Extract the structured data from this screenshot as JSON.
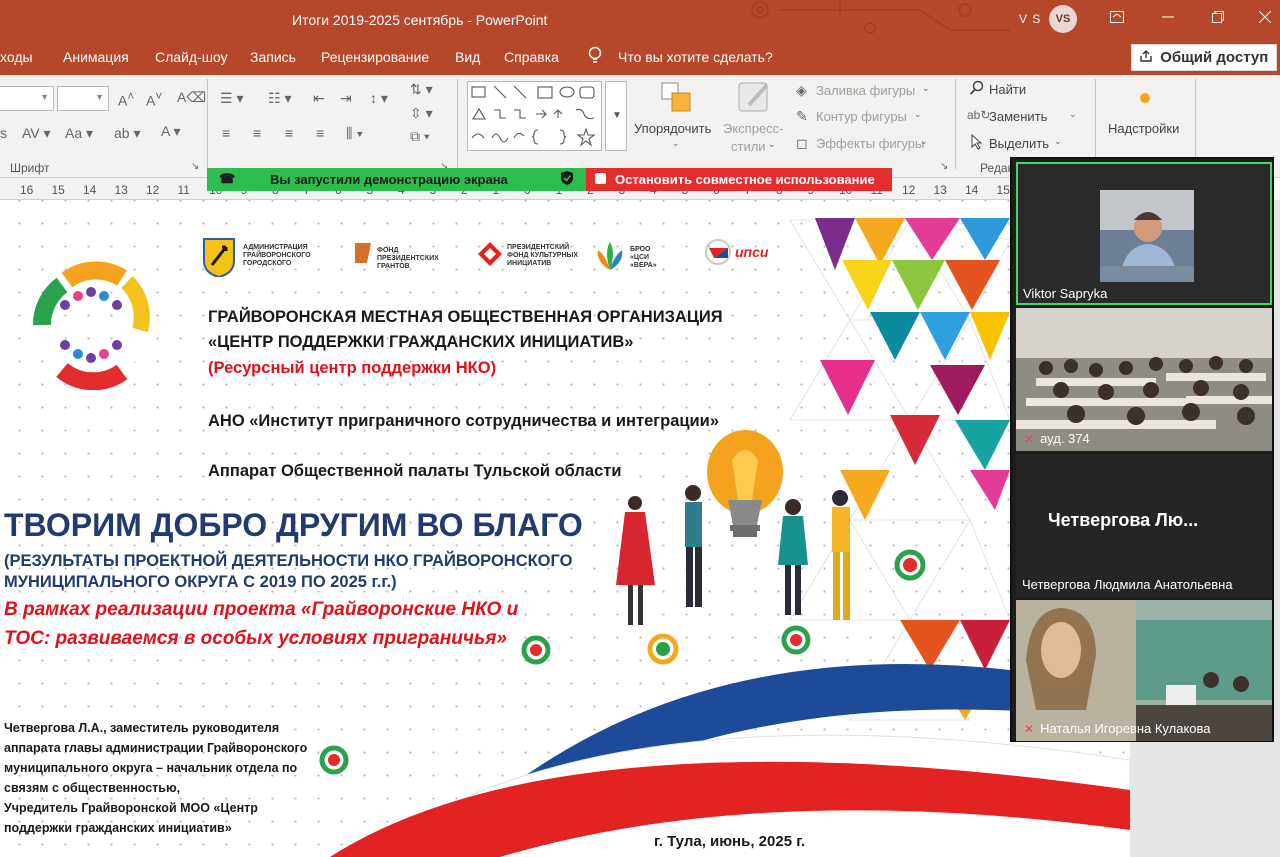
{
  "window": {
    "title": "Итоги 2019-2025 сентябрь  -  PowerPoint",
    "user_initials": "V S",
    "avatar_initials": "VS"
  },
  "menu": {
    "items": [
      "ходы",
      "Анимация",
      "Слайд-шоу",
      "Запись",
      "Рецензирование",
      "Вид",
      "Справка"
    ],
    "tell_me": "Что вы хотите сделать?",
    "share_label": "Общий доступ"
  },
  "ribbon": {
    "font_group_label": "Шрифт",
    "arrange_label": "Упорядочить",
    "express_styles_label_1": "Экспресс-",
    "express_styles_label_2": "стили",
    "shape_fill": "Заливка фигуры",
    "shape_outline": "Контур фигуры",
    "shape_effects": "Эффекты фигуры",
    "find": "Найти",
    "replace": "Заменить",
    "select": "Выделить",
    "editing_group": "Редак",
    "addins": "Надстройки"
  },
  "screen_share": {
    "started": "Вы запустили демонстрацию экрана",
    "stop": "Остановить совместное использование"
  },
  "ruler": {
    "ticks": [
      "16",
      "15",
      "14",
      "13",
      "12",
      "11",
      "10",
      "9",
      "8",
      "7",
      "6",
      "5",
      "4",
      "3",
      "2",
      "1",
      "0",
      "1",
      "2",
      "3",
      "4",
      "5",
      "6",
      "7",
      "8",
      "9",
      "10",
      "11",
      "12",
      "13",
      "14",
      "15"
    ]
  },
  "slide": {
    "partner_logos": [
      {
        "caption": "АДМИНИСТРАЦИЯ ГРАЙВОРОНСКОГО ГОРОДСКОГО"
      },
      {
        "caption": "ФОНД ПРЕЗИДЕНТСКИХ ГРАНТОВ"
      },
      {
        "caption": "ПРЕЗИДЕНТСКИЙ ФОНД КУЛЬТУРНЫХ ИНИЦИАТИВ"
      },
      {
        "caption": "БРОО «ЦСИ «ВЕРА»"
      },
      {
        "caption": "ипси"
      }
    ],
    "org_line_1": "ГРАЙВОРОНСКАЯ МЕСТНАЯ ОБЩЕСТВЕННАЯ ОРГАНИЗАЦИЯ",
    "org_line_2": "«ЦЕНТР ПОДДЕРЖКИ ГРАЖДАНСКИХ ИНИЦИАТИВ»",
    "org_line_3": "(Ресурсный центр поддержки НКО)",
    "partner_1": "АНО «Институт приграничного сотрудничества и интеграции»",
    "partner_2": "Аппарат Общественной палаты Тульской области",
    "main_title": "ТВОРИМ ДОБРО ДРУГИМ ВО БЛАГО",
    "subtitle_1": "(РЕЗУЛЬТАТЫ ПРОЕКТНОЙ ДЕЯТЕЛЬНОСТИ НКО ГРАЙВОРОНСКОГО",
    "subtitle_2": "МУНИЦИПАЛЬНОГО ОКРУГА С 2019 ПО 2025 г.г.)",
    "project_1": "В рамках реализации проекта «Грайворонские НКО и",
    "project_2": "ТОС: развиваемся в особых условиях приграничья»",
    "author_lines": [
      "Четвергова Л.А., заместитель руководителя",
      "аппарата главы администрации Грайворонского",
      "муниципального округа – начальник отдела по",
      "связям с общественностью,",
      "Учредитель Грайворонской МОО «Центр",
      "поддержки гражданских инициатив»"
    ],
    "place_date": "г. Тула, июнь, 2025 г."
  },
  "participants": [
    {
      "name": "Viktor Sapryka",
      "muted": false
    },
    {
      "name": "ауд. 374",
      "muted": true
    },
    {
      "name": "Четвергова Людмила Анатольевна",
      "muted": false,
      "placeholder": "Четвергова  Лю..."
    },
    {
      "name": "Наталья Игоревна Кулакова",
      "muted": true
    }
  ],
  "colors": {
    "office_red": "#b7472a",
    "share_green": "#2bbd4e",
    "stop_red": "#e42d2d",
    "title_navy": "#213b6e",
    "accent_red": "#e0111b",
    "active_speaker": "#3cd96b"
  }
}
